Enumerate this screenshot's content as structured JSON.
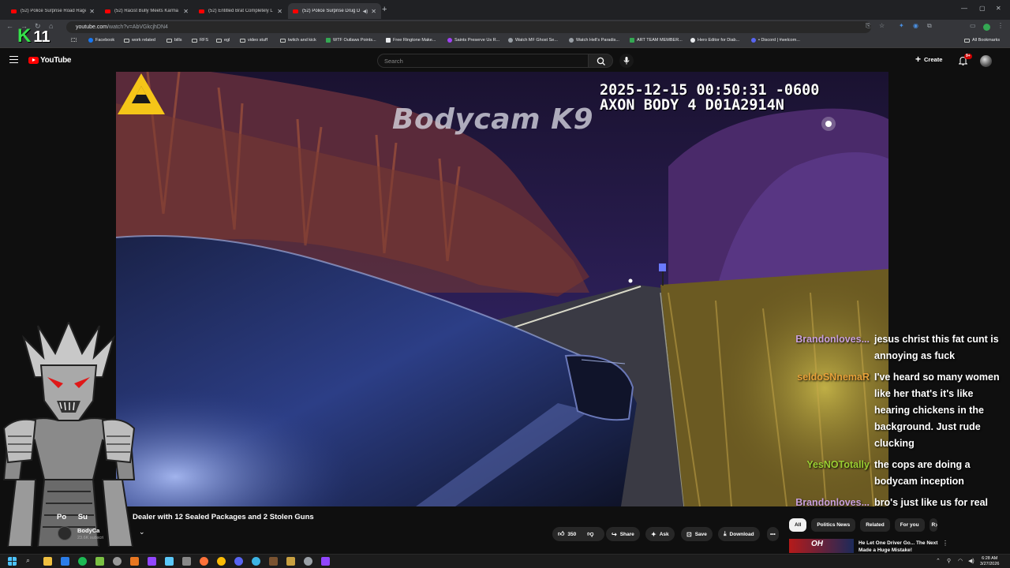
{
  "browser": {
    "tabs": [
      {
        "label": "(52) Police Surprise Road Rage",
        "active": false
      },
      {
        "label": "(52) Racist Bully Meets Karma &",
        "active": false
      },
      {
        "label": "(52) Entitled Brat Completely L",
        "active": false
      },
      {
        "label": "(52) Police Surprise Drug D",
        "active": true
      }
    ],
    "url_host": "youtube.com",
    "url_path": "/watch?v=AbVGkcjhDN4",
    "bookmarks": [
      "Facebook",
      "work related",
      "bills",
      "RFS",
      "egl",
      "video stuff",
      "twitch and kick",
      "WTF Outlaws Points...",
      "Free Ringtone Make...",
      "Saints Preserve Us R...",
      "Watch MF Ghost Se...",
      "Watch Hell's Paradis...",
      "ART TEAM MEMBER...",
      "Hero Editor for Diab...",
      "• Discord | #welcom..."
    ],
    "all_bookmarks": "All Bookmarks"
  },
  "overlay": {
    "logo_letter": "K",
    "logo_number": "11"
  },
  "youtube": {
    "logo_text": "YouTube",
    "search_placeholder": "Search",
    "create_label": "Create",
    "notifications_count": "9+"
  },
  "video": {
    "watermark": "Bodycam K9",
    "timestamp_line": "2025-12-15 00:50:31 -0600",
    "device_line": "AXON BODY 4 D01A2914N",
    "title_visible_start": "Po",
    "title_visible_mid": "Su",
    "title_visible_end": "Dealer with 12 Sealed Packages and 2 Stolen Guns",
    "channel_name": "BodyCa",
    "channel_subs": "23.6K subscri",
    "likes": "350",
    "share_label": "Share",
    "ask_label": "Ask",
    "save_label": "Save",
    "download_label": "Download"
  },
  "chat": [
    {
      "user": "Brandonloves...",
      "color": "#c9a0dc",
      "text": "jesus christ this fat cunt is annoying as fuck"
    },
    {
      "user": "seldoSNnemaR",
      "color": "#e8a23a",
      "text": "I've heard so many women like her that's it's like hearing chickens in the background. Just rude clucking"
    },
    {
      "user": "YesNOTotally",
      "color": "#9acd32",
      "text": "the cops are doing a bodycam inception"
    },
    {
      "user": "Brandonloves...",
      "color": "#c9a0dc",
      "text": "bro's just like us for real"
    }
  ],
  "chips": [
    "All",
    "Politics News",
    "Related",
    "For you",
    "R"
  ],
  "recommendation": {
    "thumb_text": "OH",
    "title": "He Let One Driver Go... The Next Made a Huge Mistake!"
  },
  "taskbar": {
    "time": "6:28 AM",
    "date": "3/27/2026"
  }
}
